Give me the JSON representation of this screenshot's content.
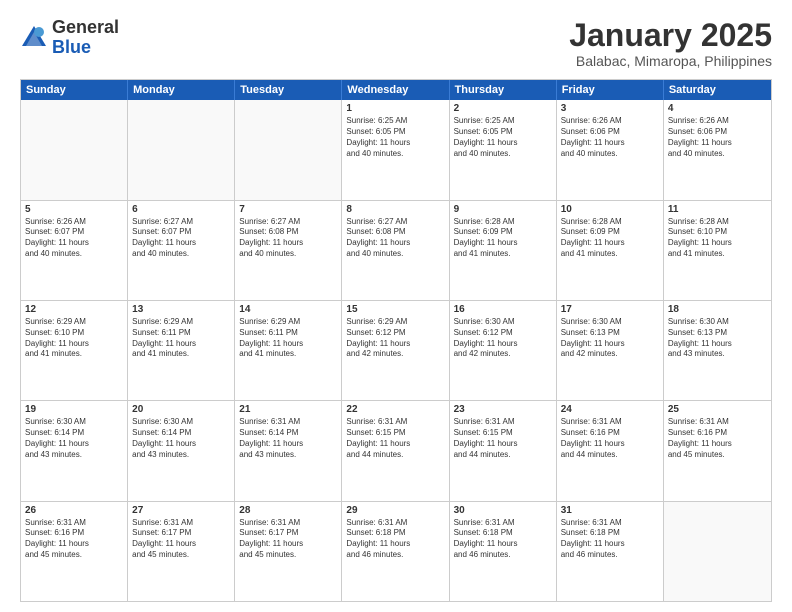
{
  "logo": {
    "general": "General",
    "blue": "Blue"
  },
  "title": "January 2025",
  "subtitle": "Balabac, Mimaropa, Philippines",
  "headers": [
    "Sunday",
    "Monday",
    "Tuesday",
    "Wednesday",
    "Thursday",
    "Friday",
    "Saturday"
  ],
  "weeks": [
    [
      {
        "day": "",
        "info": "",
        "empty": true
      },
      {
        "day": "",
        "info": "",
        "empty": true
      },
      {
        "day": "",
        "info": "",
        "empty": true
      },
      {
        "day": "1",
        "info": "Sunrise: 6:25 AM\nSunset: 6:05 PM\nDaylight: 11 hours\nand 40 minutes."
      },
      {
        "day": "2",
        "info": "Sunrise: 6:25 AM\nSunset: 6:05 PM\nDaylight: 11 hours\nand 40 minutes."
      },
      {
        "day": "3",
        "info": "Sunrise: 6:26 AM\nSunset: 6:06 PM\nDaylight: 11 hours\nand 40 minutes."
      },
      {
        "day": "4",
        "info": "Sunrise: 6:26 AM\nSunset: 6:06 PM\nDaylight: 11 hours\nand 40 minutes."
      }
    ],
    [
      {
        "day": "5",
        "info": "Sunrise: 6:26 AM\nSunset: 6:07 PM\nDaylight: 11 hours\nand 40 minutes."
      },
      {
        "day": "6",
        "info": "Sunrise: 6:27 AM\nSunset: 6:07 PM\nDaylight: 11 hours\nand 40 minutes."
      },
      {
        "day": "7",
        "info": "Sunrise: 6:27 AM\nSunset: 6:08 PM\nDaylight: 11 hours\nand 40 minutes."
      },
      {
        "day": "8",
        "info": "Sunrise: 6:27 AM\nSunset: 6:08 PM\nDaylight: 11 hours\nand 40 minutes."
      },
      {
        "day": "9",
        "info": "Sunrise: 6:28 AM\nSunset: 6:09 PM\nDaylight: 11 hours\nand 41 minutes."
      },
      {
        "day": "10",
        "info": "Sunrise: 6:28 AM\nSunset: 6:09 PM\nDaylight: 11 hours\nand 41 minutes."
      },
      {
        "day": "11",
        "info": "Sunrise: 6:28 AM\nSunset: 6:10 PM\nDaylight: 11 hours\nand 41 minutes."
      }
    ],
    [
      {
        "day": "12",
        "info": "Sunrise: 6:29 AM\nSunset: 6:10 PM\nDaylight: 11 hours\nand 41 minutes."
      },
      {
        "day": "13",
        "info": "Sunrise: 6:29 AM\nSunset: 6:11 PM\nDaylight: 11 hours\nand 41 minutes."
      },
      {
        "day": "14",
        "info": "Sunrise: 6:29 AM\nSunset: 6:11 PM\nDaylight: 11 hours\nand 41 minutes."
      },
      {
        "day": "15",
        "info": "Sunrise: 6:29 AM\nSunset: 6:12 PM\nDaylight: 11 hours\nand 42 minutes."
      },
      {
        "day": "16",
        "info": "Sunrise: 6:30 AM\nSunset: 6:12 PM\nDaylight: 11 hours\nand 42 minutes."
      },
      {
        "day": "17",
        "info": "Sunrise: 6:30 AM\nSunset: 6:13 PM\nDaylight: 11 hours\nand 42 minutes."
      },
      {
        "day": "18",
        "info": "Sunrise: 6:30 AM\nSunset: 6:13 PM\nDaylight: 11 hours\nand 43 minutes."
      }
    ],
    [
      {
        "day": "19",
        "info": "Sunrise: 6:30 AM\nSunset: 6:14 PM\nDaylight: 11 hours\nand 43 minutes."
      },
      {
        "day": "20",
        "info": "Sunrise: 6:30 AM\nSunset: 6:14 PM\nDaylight: 11 hours\nand 43 minutes."
      },
      {
        "day": "21",
        "info": "Sunrise: 6:31 AM\nSunset: 6:14 PM\nDaylight: 11 hours\nand 43 minutes."
      },
      {
        "day": "22",
        "info": "Sunrise: 6:31 AM\nSunset: 6:15 PM\nDaylight: 11 hours\nand 44 minutes."
      },
      {
        "day": "23",
        "info": "Sunrise: 6:31 AM\nSunset: 6:15 PM\nDaylight: 11 hours\nand 44 minutes."
      },
      {
        "day": "24",
        "info": "Sunrise: 6:31 AM\nSunset: 6:16 PM\nDaylight: 11 hours\nand 44 minutes."
      },
      {
        "day": "25",
        "info": "Sunrise: 6:31 AM\nSunset: 6:16 PM\nDaylight: 11 hours\nand 45 minutes."
      }
    ],
    [
      {
        "day": "26",
        "info": "Sunrise: 6:31 AM\nSunset: 6:16 PM\nDaylight: 11 hours\nand 45 minutes."
      },
      {
        "day": "27",
        "info": "Sunrise: 6:31 AM\nSunset: 6:17 PM\nDaylight: 11 hours\nand 45 minutes."
      },
      {
        "day": "28",
        "info": "Sunrise: 6:31 AM\nSunset: 6:17 PM\nDaylight: 11 hours\nand 45 minutes."
      },
      {
        "day": "29",
        "info": "Sunrise: 6:31 AM\nSunset: 6:18 PM\nDaylight: 11 hours\nand 46 minutes."
      },
      {
        "day": "30",
        "info": "Sunrise: 6:31 AM\nSunset: 6:18 PM\nDaylight: 11 hours\nand 46 minutes."
      },
      {
        "day": "31",
        "info": "Sunrise: 6:31 AM\nSunset: 6:18 PM\nDaylight: 11 hours\nand 46 minutes."
      },
      {
        "day": "",
        "info": "",
        "empty": true
      }
    ]
  ]
}
